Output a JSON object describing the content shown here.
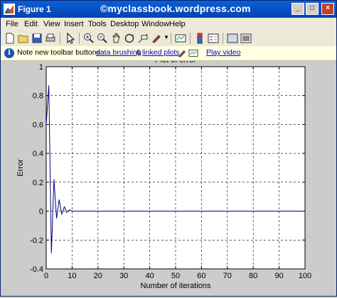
{
  "window": {
    "title": "Figure 1",
    "watermark": "©myclassbook.wordpress.com",
    "buttons": {
      "minimize": "_",
      "maximize": "□",
      "close": "×"
    }
  },
  "menu": [
    "File",
    "Edit",
    "View",
    "Insert",
    "Tools",
    "Desktop",
    "Window",
    "Help"
  ],
  "toolbar_icons": [
    "new-figure-icon",
    "open-file-icon",
    "save-icon",
    "print-icon",
    "select-arrow-icon",
    "zoom-in-icon",
    "zoom-out-icon",
    "pan-icon",
    "rotate-3d-icon",
    "data-cursor-icon",
    "brush-icon",
    "link-plot-icon",
    "colorbar-icon",
    "legend-icon",
    "hide-plot-tools-icon",
    "show-plot-tools-icon"
  ],
  "info": {
    "text_prefix": "Note new toolbar buttons:",
    "link_brushing": "data brushing",
    "amp": "&",
    "link_linked": "linked plots",
    "link_video": "Play video"
  },
  "colors": {
    "title_bar": "#0a5fd8",
    "line": "#000080",
    "link": "#0000cc"
  },
  "chart_data": {
    "type": "line",
    "title": "Plot of error",
    "xlabel": "Number of iterations",
    "ylabel": "Error",
    "xlim": [
      0,
      100
    ],
    "ylim": [
      -0.4,
      1
    ],
    "xticks": [
      "0",
      "10",
      "20",
      "30",
      "40",
      "50",
      "60",
      "70",
      "80",
      "90",
      "100"
    ],
    "yticks": [
      "-0.4",
      "-0.2",
      "0",
      "0.2",
      "0.4",
      "0.6",
      "0.8",
      "1"
    ],
    "grid": true,
    "series": [
      {
        "x": [
          0,
          1,
          2,
          3,
          4,
          5,
          6,
          7,
          8,
          9,
          10,
          11,
          12,
          15,
          20,
          30,
          40,
          50,
          60,
          70,
          80,
          90,
          100
        ],
        "y": [
          0.6,
          0.87,
          -0.29,
          0.22,
          -0.05,
          0.08,
          -0.02,
          0.03,
          -0.01,
          0.01,
          0.0,
          0.0,
          0.0,
          0.0,
          0.0,
          0.0,
          0.0,
          0.0,
          0.0,
          0.0,
          0.0,
          0.0,
          0.0
        ]
      }
    ]
  }
}
